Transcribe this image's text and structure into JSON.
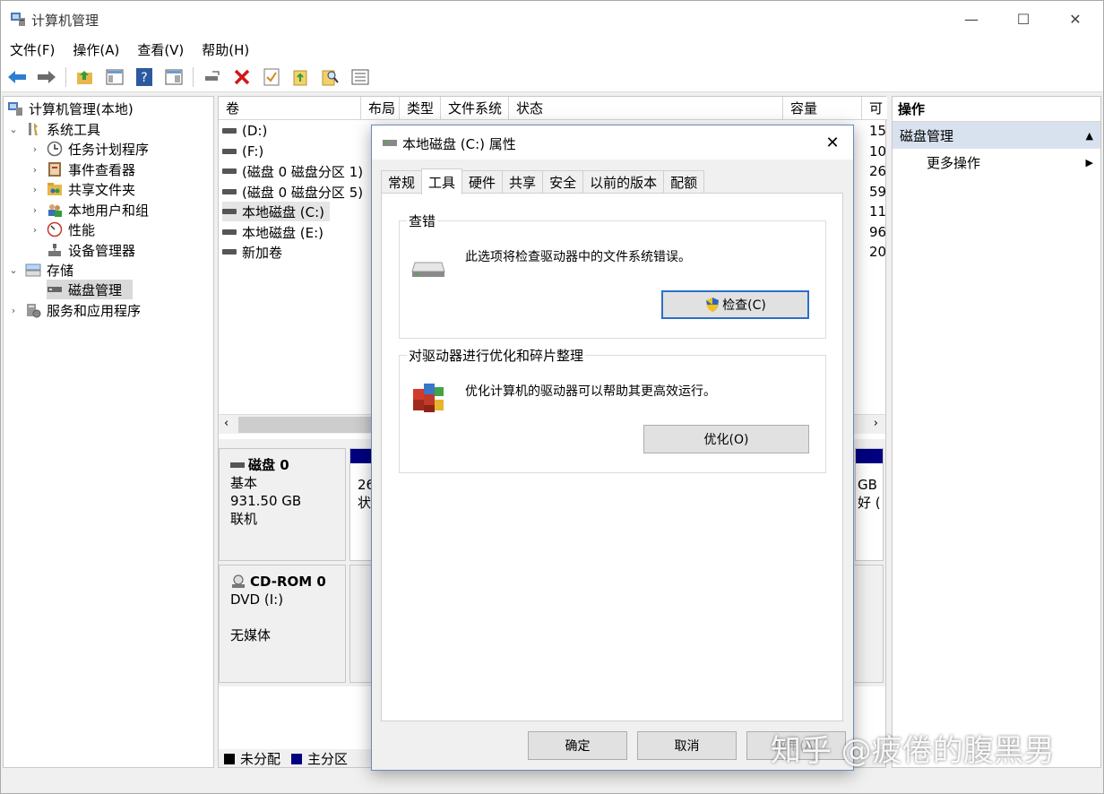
{
  "window": {
    "title": "计算机管理",
    "min": "—",
    "max": "☐",
    "close": "✕"
  },
  "menu": [
    "文件(F)",
    "操作(A)",
    "查看(V)",
    "帮助(H)"
  ],
  "tree": {
    "root": "计算机管理(本地)",
    "system_tools": "系统工具",
    "task_scheduler": "任务计划程序",
    "event_viewer": "事件查看器",
    "shared_folders": "共享文件夹",
    "local_users": "本地用户和组",
    "performance": "性能",
    "device_manager": "设备管理器",
    "storage": "存储",
    "disk_management": "磁盘管理",
    "services_apps": "服务和应用程序"
  },
  "volume_table": {
    "columns": [
      "卷",
      "布局",
      "类型",
      "文件系统",
      "状态",
      "容量",
      "可"
    ],
    "rows": [
      {
        "name": "(D:)",
        "capacity": "15"
      },
      {
        "name": "(F:)",
        "capacity": "10"
      },
      {
        "name": "(磁盘 0 磁盘分区 1)",
        "capacity": "26"
      },
      {
        "name": "(磁盘 0 磁盘分区 5)",
        "capacity": "59"
      },
      {
        "name": "本地磁盘 (C:)",
        "capacity": "11"
      },
      {
        "name": "本地磁盘 (E:)",
        "capacity": "96"
      },
      {
        "name": "新加卷",
        "capacity": "20"
      }
    ]
  },
  "disks": [
    {
      "name": "磁盘 0",
      "type": "基本",
      "size": "931.50 GB",
      "status": "联机"
    },
    {
      "name": "CD-ROM 0",
      "type": "DVD (I:)",
      "size": "",
      "status": "无媒体"
    }
  ],
  "disk_fragments": {
    "left1": "26",
    "left2": "状",
    "right1": "GB",
    "right2": "好 ("
  },
  "legend": {
    "unallocated": "未分配",
    "primary": "主分区"
  },
  "actions": {
    "header": "操作",
    "section": "磁盘管理",
    "more": "更多操作"
  },
  "dialog": {
    "title": "本地磁盘 (C:) 属性",
    "tabs": [
      "常规",
      "工具",
      "硬件",
      "共享",
      "安全",
      "以前的版本",
      "配额"
    ],
    "check": {
      "group_title": "查错",
      "text": "此选项将检查驱动器中的文件系统错误。",
      "button": "检查(C)"
    },
    "optimize": {
      "group_title": "对驱动器进行优化和碎片整理",
      "text": "优化计算机的驱动器可以帮助其更高效运行。",
      "button": "优化(O)"
    },
    "ok": "确定",
    "cancel": "取消",
    "apply": "应用(A)"
  },
  "watermark": "知乎 @疲倦的腹黑男",
  "colors": {
    "primary_partition": "#000080",
    "unallocated": "#000000",
    "selection": "#d8e2ef",
    "button_focus": "#2a6fc9"
  }
}
